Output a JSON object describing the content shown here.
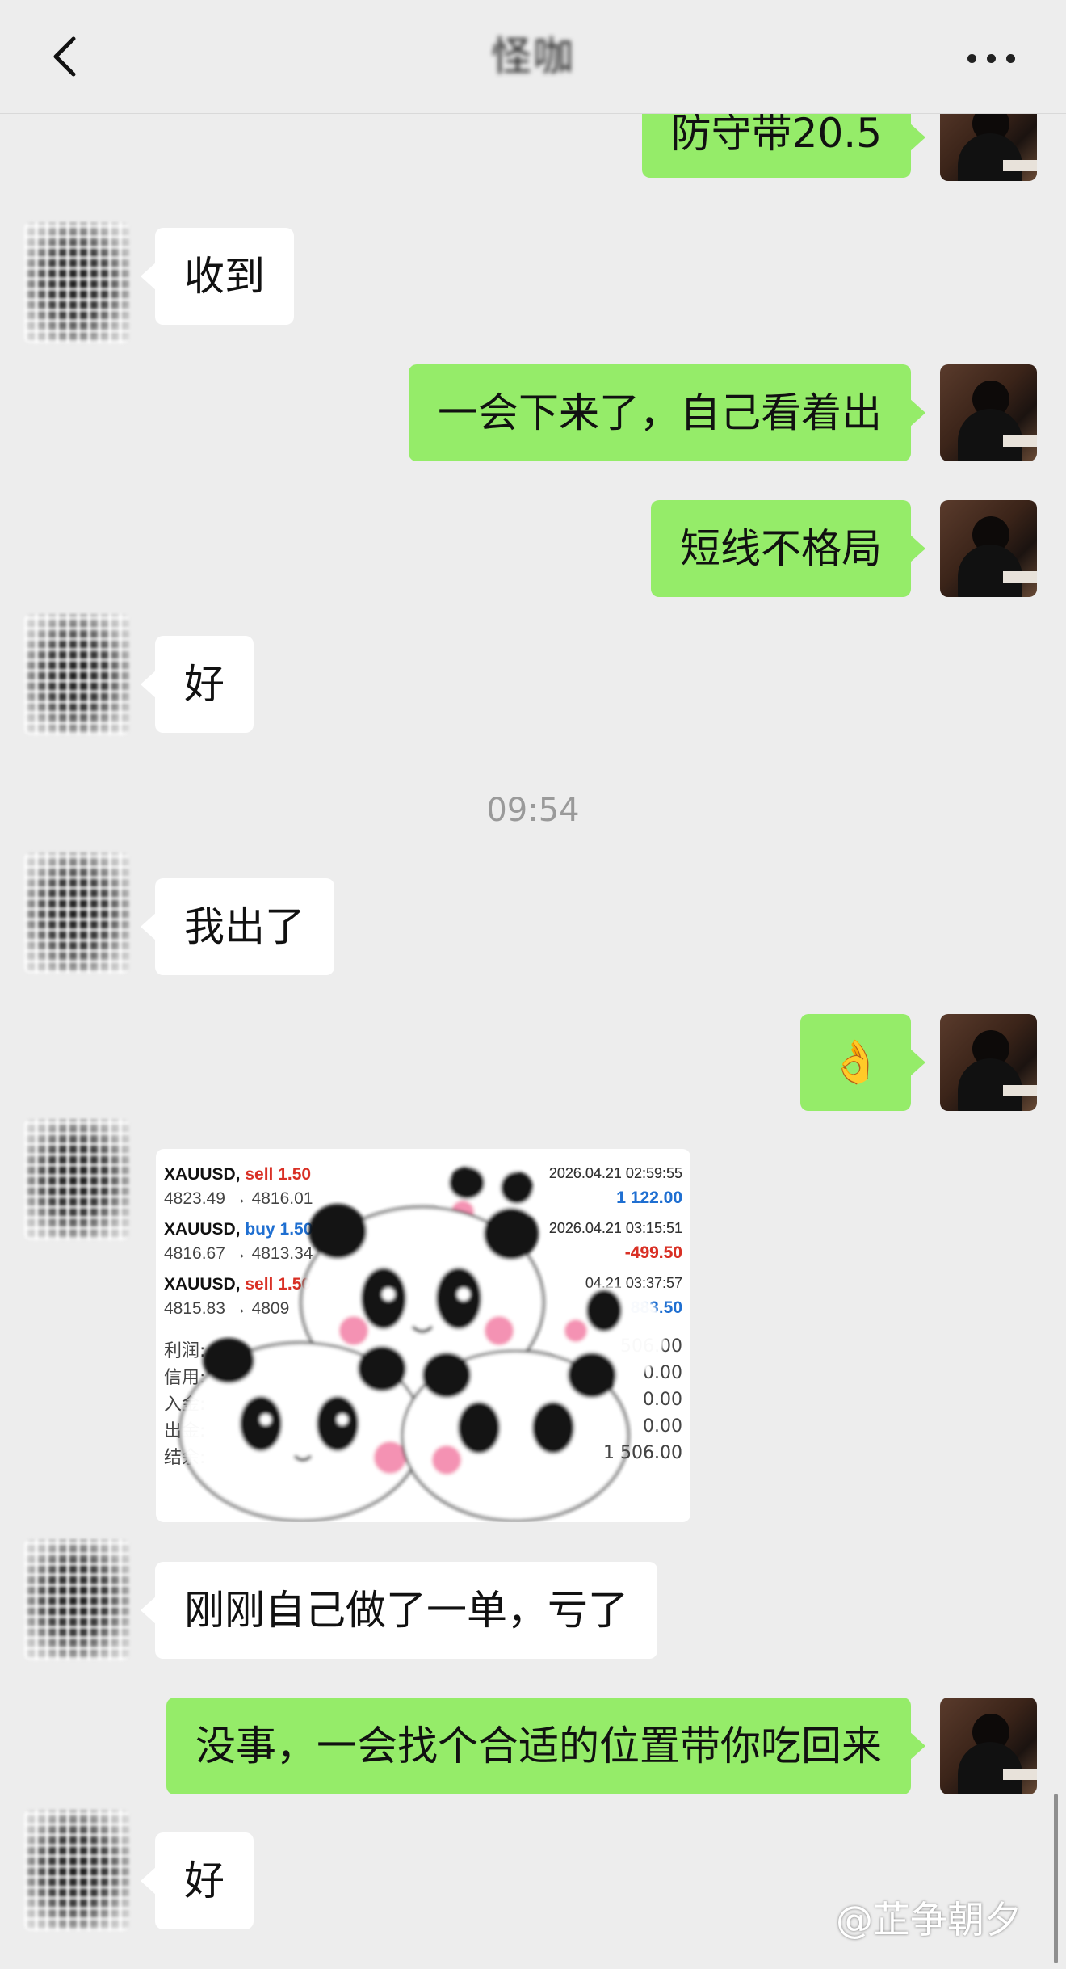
{
  "header": {
    "title": "怪咖"
  },
  "messages": [
    {
      "text": "防守带20.5"
    },
    {
      "text": "收到"
    },
    {
      "text": "一会下来了，自己看着出"
    },
    {
      "text": "短线不格局"
    },
    {
      "text": "好"
    },
    {
      "text": "我出了"
    },
    {
      "text": "👌"
    },
    {
      "text": "刚刚自己做了一单，亏了"
    },
    {
      "text": "没事，一会找个合适的位置带你吃回来"
    },
    {
      "text": "好"
    }
  ],
  "timestamp": "09:54",
  "image": {
    "trades": [
      {
        "symbol": "XAUUSD,",
        "side": "sell 1.50",
        "prices": "4823.49 → 4816.01",
        "date": "2026.04.21 02:59:55",
        "profit": "1 122.00"
      },
      {
        "symbol": "XAUUSD,",
        "side": "buy 1.50",
        "prices": "4816.67 → 4813.34",
        "date": "2026.04.21 03:15:51",
        "profit": "-499.50"
      },
      {
        "symbol": "XAUUSD,",
        "side": "sell 1.50",
        "prices": "4815.83 → 4809",
        "date": "04.21 03:37:57",
        "profit": "883.50"
      }
    ],
    "summary": [
      {
        "label": "利润:",
        "value": "506.00"
      },
      {
        "label": "信用:",
        "value": "0.00"
      },
      {
        "label": "入金:",
        "value": "0.00"
      },
      {
        "label": "出金:",
        "value": "0.00"
      },
      {
        "label": "结余:",
        "value": "1 506.00"
      }
    ]
  },
  "watermark": "@芷争朝夕",
  "colors": {
    "outgoing_bubble": "#95ec69",
    "incoming_bubble": "#ffffff",
    "background": "#ededed",
    "loss": "#d93025",
    "gain": "#1f6fd1"
  }
}
